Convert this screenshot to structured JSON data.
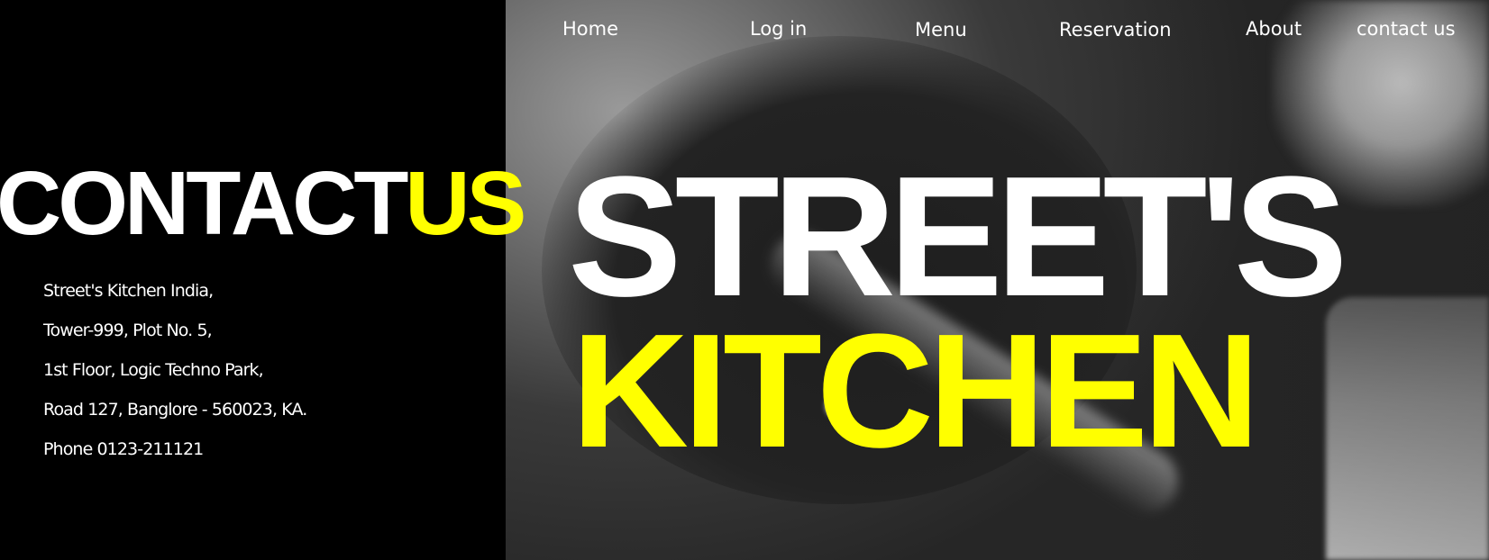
{
  "nav": {
    "items": [
      {
        "label": "Home"
      },
      {
        "label": "Log in"
      },
      {
        "label": "Menu"
      },
      {
        "label": "Reservation"
      },
      {
        "label": "About"
      },
      {
        "label": "contact us"
      }
    ]
  },
  "contact": {
    "heading_part1": "CONTACT",
    "heading_part2": "US",
    "address_lines": [
      "Street's Kitchen India,",
      "Tower-999, Plot No. 5,",
      "1st Floor, Logic Techno Park,",
      "Road 127, Banglore - 560023, KA.",
      "Phone 0123-211121"
    ]
  },
  "hero": {
    "line1": "STREET'S",
    "line2": "KITCHEN"
  },
  "colors": {
    "accent": "#ffff00",
    "text": "#ffffff",
    "panel_background": "#000000"
  }
}
